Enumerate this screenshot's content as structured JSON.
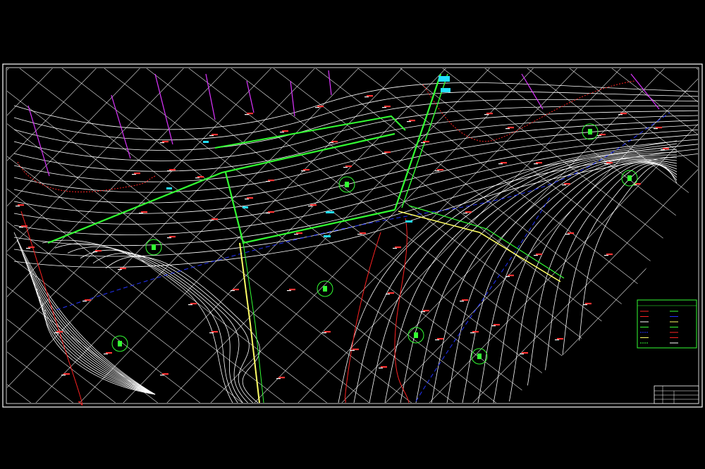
{
  "drawing": {
    "background": "#000000",
    "colors": {
      "frame": "#ffffff",
      "contour": "#ffffff",
      "grid": "#ffffff",
      "road_main": "#33ff33",
      "road_secondary": "#ffff66",
      "boundary_red": "#ff2222",
      "dashed_blue": "#2233ff",
      "magenta": "#dd33ff",
      "cyan_label": "#22e0ff",
      "elevation_label": "#ff3333"
    }
  },
  "legend": {
    "title_left": "",
    "title_right": "",
    "rows": [
      {
        "left": "",
        "right": ""
      },
      {
        "left": "",
        "right": ""
      },
      {
        "left": "",
        "right": ""
      },
      {
        "left": "",
        "right": ""
      },
      {
        "left": "",
        "right": ""
      },
      {
        "left": "",
        "right": ""
      },
      {
        "left": "",
        "right": ""
      }
    ]
  },
  "title_block": {
    "heading": ""
  },
  "map_markers": [
    {
      "name": "green-circle-marker"
    },
    {
      "name": "green-circle-marker"
    },
    {
      "name": "green-circle-marker"
    },
    {
      "name": "green-circle-marker"
    },
    {
      "name": "green-circle-marker"
    },
    {
      "name": "green-circle-marker"
    },
    {
      "name": "green-circle-marker"
    },
    {
      "name": "green-circle-marker"
    }
  ]
}
